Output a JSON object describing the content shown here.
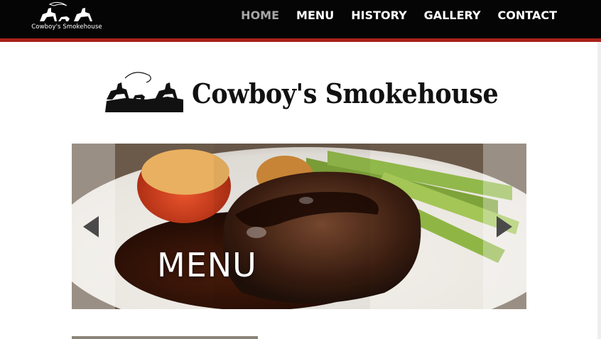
{
  "nav": {
    "logo_text": "Cowboy's Smokehouse",
    "items": [
      {
        "label": "HOME",
        "active": true
      },
      {
        "label": "MENU",
        "active": false
      },
      {
        "label": "HISTORY",
        "active": false
      },
      {
        "label": "GALLERY",
        "active": false
      },
      {
        "label": "CONTACT",
        "active": false
      }
    ]
  },
  "brand": {
    "title": "Cowboy's Smokehouse"
  },
  "slider": {
    "caption": "MENU",
    "prev_icon": "arrow-left-icon",
    "next_icon": "arrow-right-icon"
  },
  "colors": {
    "nav_bg": "#050505",
    "accent_red": "#a8221a",
    "nav_active": "#a6a6a6"
  }
}
